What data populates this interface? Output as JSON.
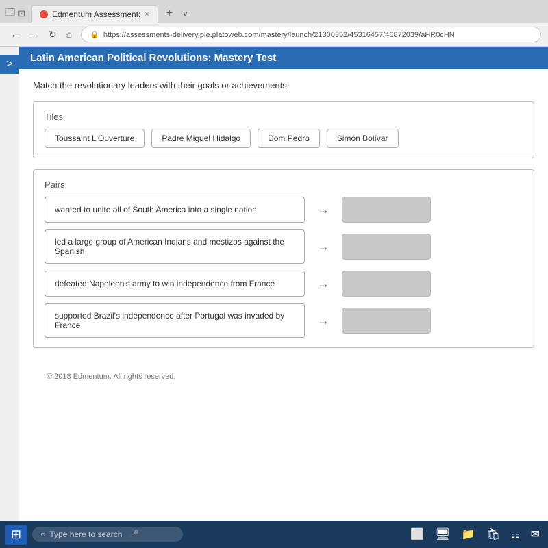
{
  "browser": {
    "tab_label": "Edmentum Assessment:",
    "tab_close": "×",
    "tab_new": "+",
    "url": "https://assessments-delivery.ple.platoweb.com/mastery/launch/21300352/45316457/46872039/aHR0cHN",
    "nav_back": "←",
    "nav_forward": "→",
    "nav_refresh": "↻",
    "nav_home": "⌂"
  },
  "sidebar": {
    "arrow": ">"
  },
  "page": {
    "title": "Latin American Political Revolutions: Mastery Test",
    "instruction": "Match the revolutionary leaders with their goals or achievements."
  },
  "tiles": {
    "label": "Tiles",
    "items": [
      {
        "id": "toussaint",
        "label": "Toussaint L'Ouverture"
      },
      {
        "id": "padre",
        "label": "Padre Miguel Hidalgo"
      },
      {
        "id": "dom",
        "label": "Dom Pedro"
      },
      {
        "id": "simon",
        "label": "Simón Bolívar"
      }
    ]
  },
  "pairs": {
    "label": "Pairs",
    "items": [
      {
        "id": "pair1",
        "clue": "wanted to unite all of South America into a single nation",
        "answer": ""
      },
      {
        "id": "pair2",
        "clue": "led a large group of American Indians and mestizos against the Spanish",
        "answer": ""
      },
      {
        "id": "pair3",
        "clue": "defeated Napoleon's army to win independence from France",
        "answer": ""
      },
      {
        "id": "pair4",
        "clue": "supported Brazil's independence after Portugal was invaded by France",
        "answer": ""
      }
    ]
  },
  "footer": {
    "copyright": "© 2018 Edmentum. All rights reserved."
  },
  "taskbar": {
    "search_placeholder": "Type here to search"
  }
}
